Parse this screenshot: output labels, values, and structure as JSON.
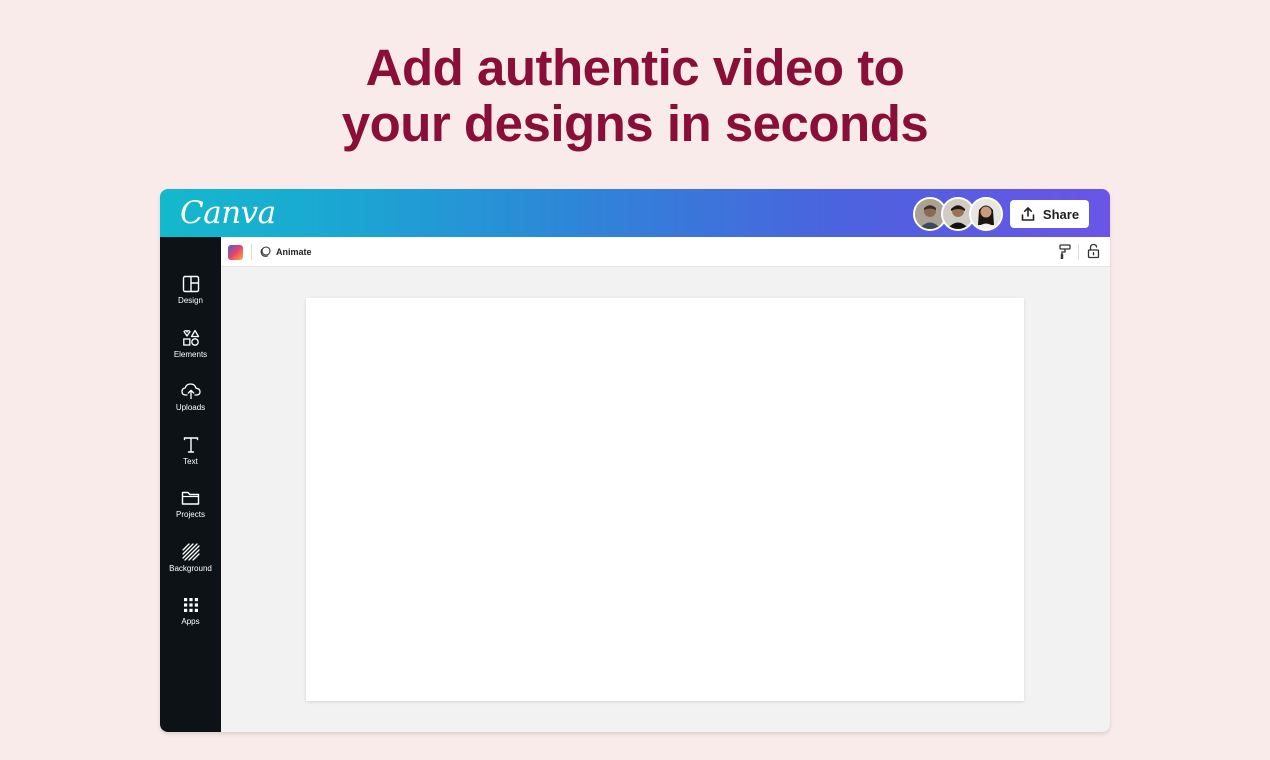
{
  "headline": {
    "line1": "Add authentic video to",
    "line2": "your designs in seconds"
  },
  "app": {
    "logo": "Canva",
    "share_label": "Share",
    "collaborators": [
      "avatar-1",
      "avatar-2",
      "avatar-3"
    ]
  },
  "sidebar": {
    "items": [
      {
        "label": "Design",
        "icon": "layout-icon"
      },
      {
        "label": "Elements",
        "icon": "shapes-icon"
      },
      {
        "label": "Uploads",
        "icon": "cloud-upload-icon"
      },
      {
        "label": "Text",
        "icon": "text-icon"
      },
      {
        "label": "Projects",
        "icon": "folder-icon"
      },
      {
        "label": "Background",
        "icon": "hatch-icon"
      },
      {
        "label": "Apps",
        "icon": "grid-icon"
      }
    ]
  },
  "toolbar": {
    "animate_label": "Animate"
  },
  "colors": {
    "headline": "#8a0f38",
    "page_background": "#f9ebea",
    "sidebar": "#0d1216",
    "gradient_start": "#14b9cc",
    "gradient_end": "#6a55e6"
  }
}
